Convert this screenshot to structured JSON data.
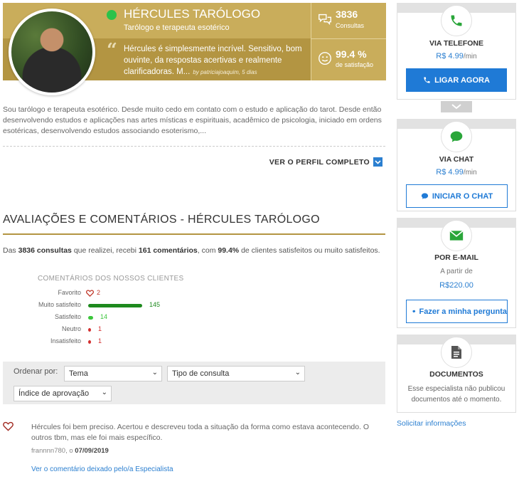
{
  "expert": {
    "name": "HÉRCULES TARÓLOGO",
    "subtitle": "Tarólogo e terapeuta esotérico",
    "quote": "Hércules é simplesmente incrível. Sensitivo, bom ouvinte, da respostas acertivas e realmente clarificadoras. M...",
    "quote_by": "by patriciajoaquim, 5 dias",
    "consultas_num": "3836",
    "consultas_label": "Consultas",
    "satisfacao_num": "99.4 %",
    "satisfacao_label": "de satisfação",
    "status_color": "#2bc24a"
  },
  "bio": "Sou tarólogo e terapeuta esotérico. Desde muito cedo em contato com o estudo e aplicação do tarot. Desde então desenvolvendo estudos e aplicações nas artes místicas e espirituais, acadêmico de psicologia, iniciado em ordens esotéricas, desenvolvendo estudos associando esoterismo,...",
  "profile_link": "VER O PERFIL COMPLETO",
  "reviews": {
    "title": "AVALIAÇÕES E COMENTÁRIOS - HÉRCULES TARÓLOGO",
    "summary_prefix": "Das",
    "summary_consultas": "3836 consultas",
    "summary_mid": "que realizei, recebi",
    "summary_comments": "161 comentários",
    "summary_mid2": ", com",
    "summary_pct": "99.4%",
    "summary_suffix": "de clientes satisfeitos ou muito satisfeitos.",
    "chart_title": "COMENTÁRIOS DOS NOSSOS CLIENTES"
  },
  "chart_data": {
    "type": "bar",
    "categories": [
      "Favorito",
      "Muito satisfeito",
      "Satisfeito",
      "Neutro",
      "Insatisfeito"
    ],
    "values": [
      2,
      145,
      14,
      1,
      1
    ],
    "colors": [
      "#c0392b",
      "#1e8a1e",
      "#3cc63c",
      "#d32f2f",
      "#d32f2f"
    ]
  },
  "filters": {
    "label": "Ordenar por:",
    "tema": "Tema",
    "tipo": "Tipo de consulta",
    "indice": "Índice de aprovação"
  },
  "comment": {
    "text": "Hércules foi bem preciso. Acertou e descreveu toda a situação da forma como estava acontecendo. O outros tbm, mas ele foi mais específico.",
    "author": "frannnn780",
    "date_prefix": ", o",
    "date": "07/09/2019",
    "see_reply": "Ver o comentário deixado pelo/a Especialista"
  },
  "sidebar": {
    "phone_title": "VIA TELEFONE",
    "phone_price": "R$ 4.99",
    "phone_unit": "/min",
    "phone_button": "LIGAR AGORA",
    "chat_title": "VIA CHAT",
    "chat_price": "R$ 4.99",
    "chat_unit": "/min",
    "chat_button": "INICIAR O CHAT",
    "email_title": "POR E-MAIL",
    "email_from": "A partir de",
    "email_price": "R$220.00",
    "email_button": "Fazer a minha pergunta",
    "docs_title": "DOCUMENTOS",
    "docs_text": "Esse especialista não publicou documentos até o momento.",
    "solicit": "Solicitar informações",
    "accent_green": "#2aa63a",
    "accent_blue": "#1f7ad6"
  }
}
